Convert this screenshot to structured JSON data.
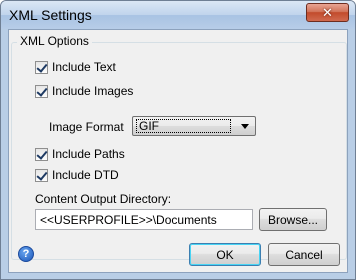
{
  "window": {
    "title": "XML Settings",
    "close_glyph": "✕"
  },
  "group": {
    "label": "XML Options"
  },
  "options": {
    "include_text": {
      "label": "Include Text",
      "checked": true
    },
    "include_images": {
      "label": "Include Images",
      "checked": true
    },
    "image_format": {
      "label": "Image Format",
      "value": "GIF"
    },
    "include_paths": {
      "label": "Include Paths",
      "checked": true
    },
    "include_dtd": {
      "label": "Include DTD",
      "checked": true
    }
  },
  "output": {
    "label": "Content Output Directory:",
    "value": "<<USERPROFILE>>\\Documents",
    "browse_label": "Browse..."
  },
  "footer": {
    "help_glyph": "?",
    "ok_label": "OK",
    "cancel_label": "Cancel"
  }
}
